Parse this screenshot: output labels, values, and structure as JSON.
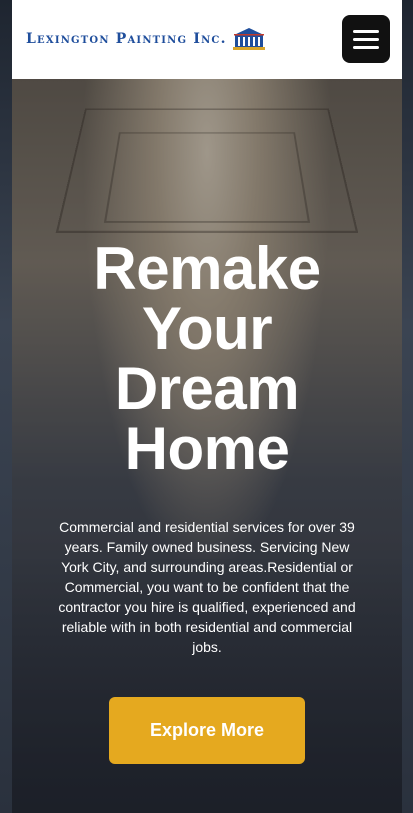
{
  "header": {
    "logo_text": "Lexington Painting Inc.",
    "menu_icon": "hamburger-menu-icon"
  },
  "hero": {
    "title_lines": [
      "Remake",
      "Your",
      "Dream",
      "Home"
    ],
    "description": "Commercial and residential services for over 39 years. Family owned business. Servicing New York City, and surrounding areas.Residential or Commercial, you want to be confident that the contractor you hire is qualified, experienced and reliable with in both residential and commercial jobs.",
    "cta_label": "Explore More"
  },
  "colors": {
    "accent": "#e5a91f",
    "logo_blue": "#1f4e9c",
    "menu_button": "#111111"
  }
}
